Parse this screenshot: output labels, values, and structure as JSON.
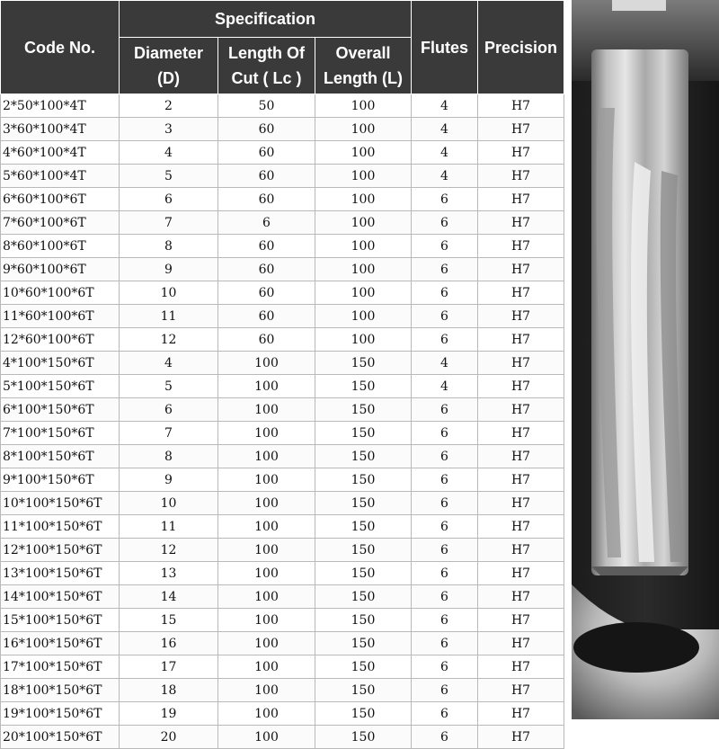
{
  "table": {
    "headers": {
      "code_no": "Code No.",
      "specification": "Specification",
      "diameter": [
        "Diameter",
        "(D)"
      ],
      "length_of_cut": [
        "Length Of",
        "Cut ( Lc )"
      ],
      "overall_length": [
        "Overall",
        "Length (L)"
      ],
      "flutes": "Flutes",
      "precision": "Precision"
    },
    "rows": [
      [
        "2*50*100*4T",
        "2",
        "50",
        "100",
        "4",
        "H7"
      ],
      [
        "3*60*100*4T",
        "3",
        "60",
        "100",
        "4",
        "H7"
      ],
      [
        "4*60*100*4T",
        "4",
        "60",
        "100",
        "4",
        "H7"
      ],
      [
        "5*60*100*4T",
        "5",
        "60",
        "100",
        "4",
        "H7"
      ],
      [
        "6*60*100*6T",
        "6",
        "60",
        "100",
        "6",
        "H7"
      ],
      [
        "7*60*100*6T",
        "7",
        "6",
        "100",
        "6",
        "H7"
      ],
      [
        "8*60*100*6T",
        "8",
        "60",
        "100",
        "6",
        "H7"
      ],
      [
        "9*60*100*6T",
        "9",
        "60",
        "100",
        "6",
        "H7"
      ],
      [
        "10*60*100*6T",
        "10",
        "60",
        "100",
        "6",
        "H7"
      ],
      [
        "11*60*100*6T",
        "11",
        "60",
        "100",
        "6",
        "H7"
      ],
      [
        "12*60*100*6T",
        "12",
        "60",
        "100",
        "6",
        "H7"
      ],
      [
        "4*100*150*6T",
        "4",
        "100",
        "150",
        "4",
        "H7"
      ],
      [
        "5*100*150*6T",
        "5",
        "100",
        "150",
        "4",
        "H7"
      ],
      [
        "6*100*150*6T",
        "6",
        "100",
        "150",
        "6",
        "H7"
      ],
      [
        "7*100*150*6T",
        "7",
        "100",
        "150",
        "6",
        "H7"
      ],
      [
        "8*100*150*6T",
        "8",
        "100",
        "150",
        "6",
        "H7"
      ],
      [
        "9*100*150*6T",
        "9",
        "100",
        "150",
        "6",
        "H7"
      ],
      [
        "10*100*150*6T",
        "10",
        "100",
        "150",
        "6",
        "H7"
      ],
      [
        "11*100*150*6T",
        "11",
        "100",
        "150",
        "6",
        "H7"
      ],
      [
        "12*100*150*6T",
        "12",
        "100",
        "150",
        "6",
        "H7"
      ],
      [
        "13*100*150*6T",
        "13",
        "100",
        "150",
        "6",
        "H7"
      ],
      [
        "14*100*150*6T",
        "14",
        "100",
        "150",
        "6",
        "H7"
      ],
      [
        "15*100*150*6T",
        "15",
        "100",
        "150",
        "6",
        "H7"
      ],
      [
        "16*100*150*6T",
        "16",
        "100",
        "150",
        "6",
        "H7"
      ],
      [
        "17*100*150*6T",
        "17",
        "100",
        "150",
        "6",
        "H7"
      ],
      [
        "18*100*150*6T",
        "18",
        "100",
        "150",
        "6",
        "H7"
      ],
      [
        "19*100*150*6T",
        "19",
        "100",
        "150",
        "6",
        "H7"
      ],
      [
        "20*100*150*6T",
        "20",
        "100",
        "150",
        "6",
        "H7"
      ]
    ]
  },
  "colors": {
    "header_bg": "#3a3a3a",
    "header_text": "#ffffff",
    "grid": "#b9b9b9"
  },
  "photo": {
    "subject": "reamer-tool-photo"
  }
}
